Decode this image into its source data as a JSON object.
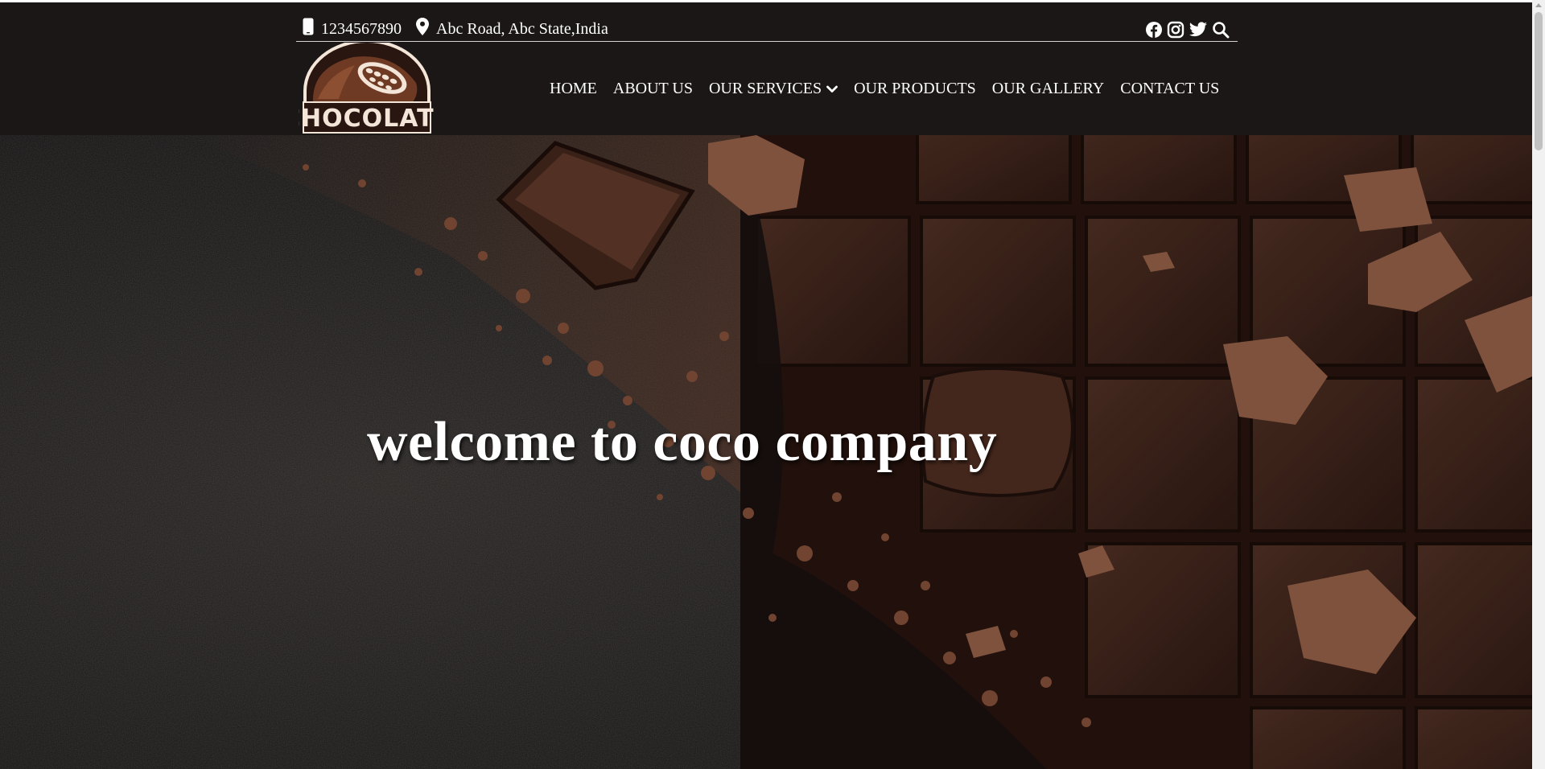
{
  "topbar": {
    "phone": "1234567890",
    "address": "Abc Road, Abc State,India",
    "social_icons": [
      "facebook-icon",
      "instagram-icon",
      "twitter-icon",
      "search-icon"
    ]
  },
  "logo": {
    "text": "CHOCOLATE"
  },
  "nav": {
    "items": [
      {
        "label": "HOME"
      },
      {
        "label": "ABOUT US"
      },
      {
        "label": "OUR SERVICES",
        "dropdown_icon": "chevron-down-icon"
      },
      {
        "label": "OUR PRODUCTS"
      },
      {
        "label": "OUR GALLERY"
      },
      {
        "label": "CONTACT US"
      }
    ]
  },
  "hero": {
    "title": "welcome to coco company"
  },
  "colors": {
    "header_bg": "#1c1717",
    "logo_brown": "#6e3a24",
    "logo_cream": "#f3e6d8",
    "chocolate": "#3b2219",
    "cocoa_powder": "#7a4a35"
  }
}
